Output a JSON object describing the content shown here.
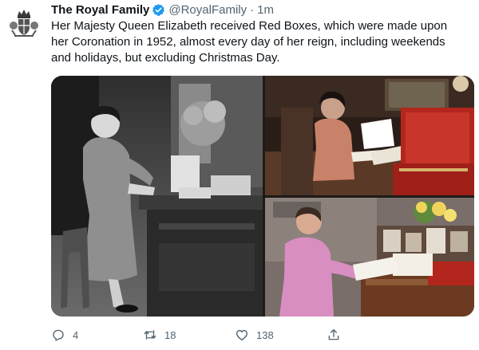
{
  "tweet": {
    "author_name": "The Royal Family",
    "handle": "@RoyalFamily",
    "separator": "·",
    "time": "1m",
    "text": "Her Majesty Queen Elizabeth received Red Boxes, which were made upon her Coronation in 1952, almost every day of her reign, including weekends and holidays, but excluding Christmas Day."
  },
  "icons": {
    "avatar": "royal-crest-icon",
    "verified": "verified-badge-icon",
    "reply": "reply-icon",
    "retweet": "retweet-icon",
    "like": "like-icon",
    "share": "share-icon"
  },
  "colors": {
    "verified_blue": "#1d9bf0",
    "muted_text": "#536471",
    "text": "#0f1419",
    "red_box": "#b3261e"
  },
  "actions": {
    "reply_count": "4",
    "retweet_count": "18",
    "like_count": "138"
  }
}
